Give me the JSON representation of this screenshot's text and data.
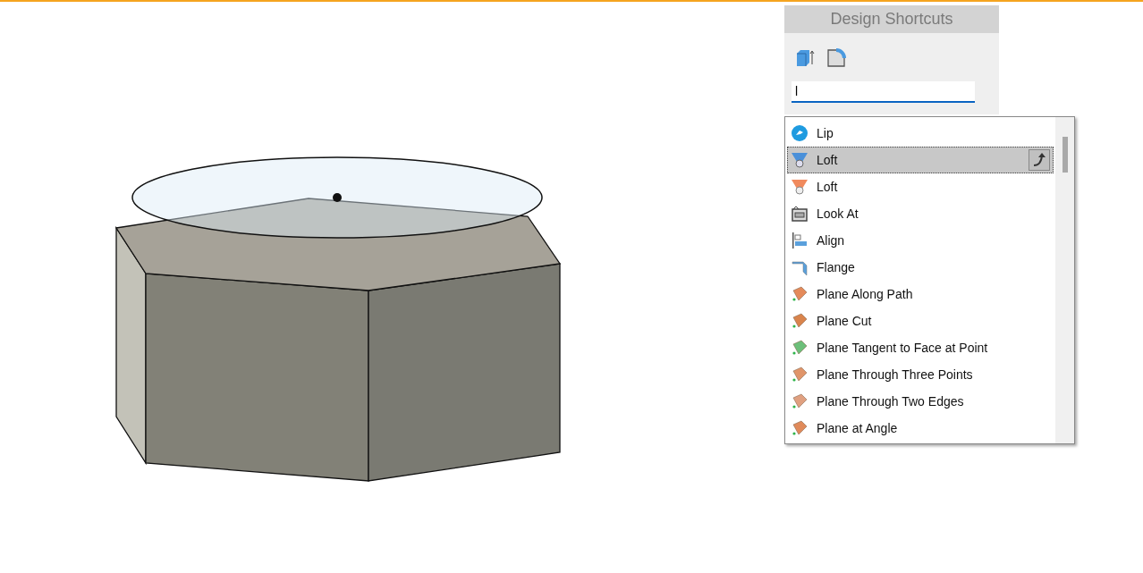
{
  "panel": {
    "title": "Design Shortcuts"
  },
  "search": {
    "value": "l"
  },
  "suggestions": [
    {
      "label": "Lip",
      "selected": false
    },
    {
      "label": "Loft",
      "selected": true
    },
    {
      "label": "Loft",
      "selected": false
    },
    {
      "label": "Look At",
      "selected": false
    },
    {
      "label": "Align",
      "selected": false
    },
    {
      "label": "Flange",
      "selected": false
    },
    {
      "label": "Plane Along Path",
      "selected": false
    },
    {
      "label": "Plane Cut",
      "selected": false
    },
    {
      "label": "Plane Tangent to Face at Point",
      "selected": false
    },
    {
      "label": "Plane Through Three Points",
      "selected": false
    },
    {
      "label": "Plane Through Two Edges",
      "selected": false
    },
    {
      "label": "Plane at Angle",
      "selected": false
    }
  ]
}
